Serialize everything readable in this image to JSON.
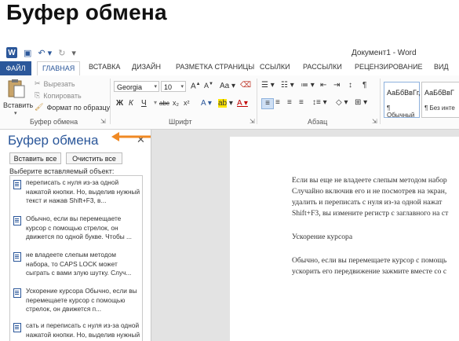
{
  "heading": "Буфер обмена",
  "window": {
    "title": "Документ1 - Word"
  },
  "tabs": {
    "file": "ФАЙЛ",
    "items": [
      "ГЛАВНАЯ",
      "ВСТАВКА",
      "ДИЗАЙН",
      "РАЗМЕТКА СТРАНИЦЫ",
      "ССЫЛКИ",
      "РАССЫЛКИ",
      "РЕЦЕНЗИРОВАНИЕ",
      "ВИД"
    ]
  },
  "ribbon": {
    "clipboard": {
      "paste": "Вставить",
      "cut": "Вырезать",
      "copy": "Копировать",
      "format_painter": "Формат по образцу",
      "group_label": "Буфер обмена"
    },
    "font": {
      "name": "Georgia",
      "size": "10",
      "grow": "A",
      "shrink": "A",
      "case": "Aa",
      "bold": "Ж",
      "italic": "К",
      "underline": "Ч",
      "strike": "abc",
      "subscript": "x₂",
      "superscript": "x²",
      "group_label": "Шрифт"
    },
    "paragraph": {
      "group_label": "Абзац",
      "pilcrow": "¶"
    },
    "styles": {
      "s1_sample": "АаБбВвГг,",
      "s1_name": "¶ Обычный",
      "s2_sample": "АаБбВвГ",
      "s2_name": "¶ Без инте"
    }
  },
  "clipboard_pane": {
    "title": "Буфер обмена",
    "paste_all": "Вставить все",
    "clear_all": "Очистить все",
    "hint": "Выберите вставляемый объект:",
    "items": [
      {
        "text": "переписать с нуля из-за одной нажатой кнопки. Но, выделив нужный текст и нажав Shift+F3, в..."
      },
      {
        "text": "Обычно, если вы перемещаете курсор с помощью стрелок, он движется по одной букве. Чтобы ..."
      },
      {
        "text": "не владеете слепым методом набора, то CAPS LOCK может сыграть с вами злую шутку. Случ..."
      },
      {
        "text": "Ускорение курсора Обычно, если вы перемещаете курсор с помощью стрелок, он движется п..."
      },
      {
        "text": "сать и переписать с нуля из-за одной нажатой кнопки. Но, выделив нужный текст и нажав S..."
      }
    ]
  },
  "document": {
    "lines": [
      "Если вы еще не владеете слепым методом набор",
      "Случайно включив его и не посмотрев на экран,",
      "удалить и переписать с нуля из-за одной нажат",
      "Shift+F3, вы измените регистр с заглавного на ст",
      "Ускорение курсора",
      "Обычно, если вы перемещаете курсор с помощь",
      "ускорить его передвижение зажмите вместе со с"
    ]
  },
  "colors": {
    "accent": "#2b579a",
    "callout_arrow": "#f08a24"
  }
}
